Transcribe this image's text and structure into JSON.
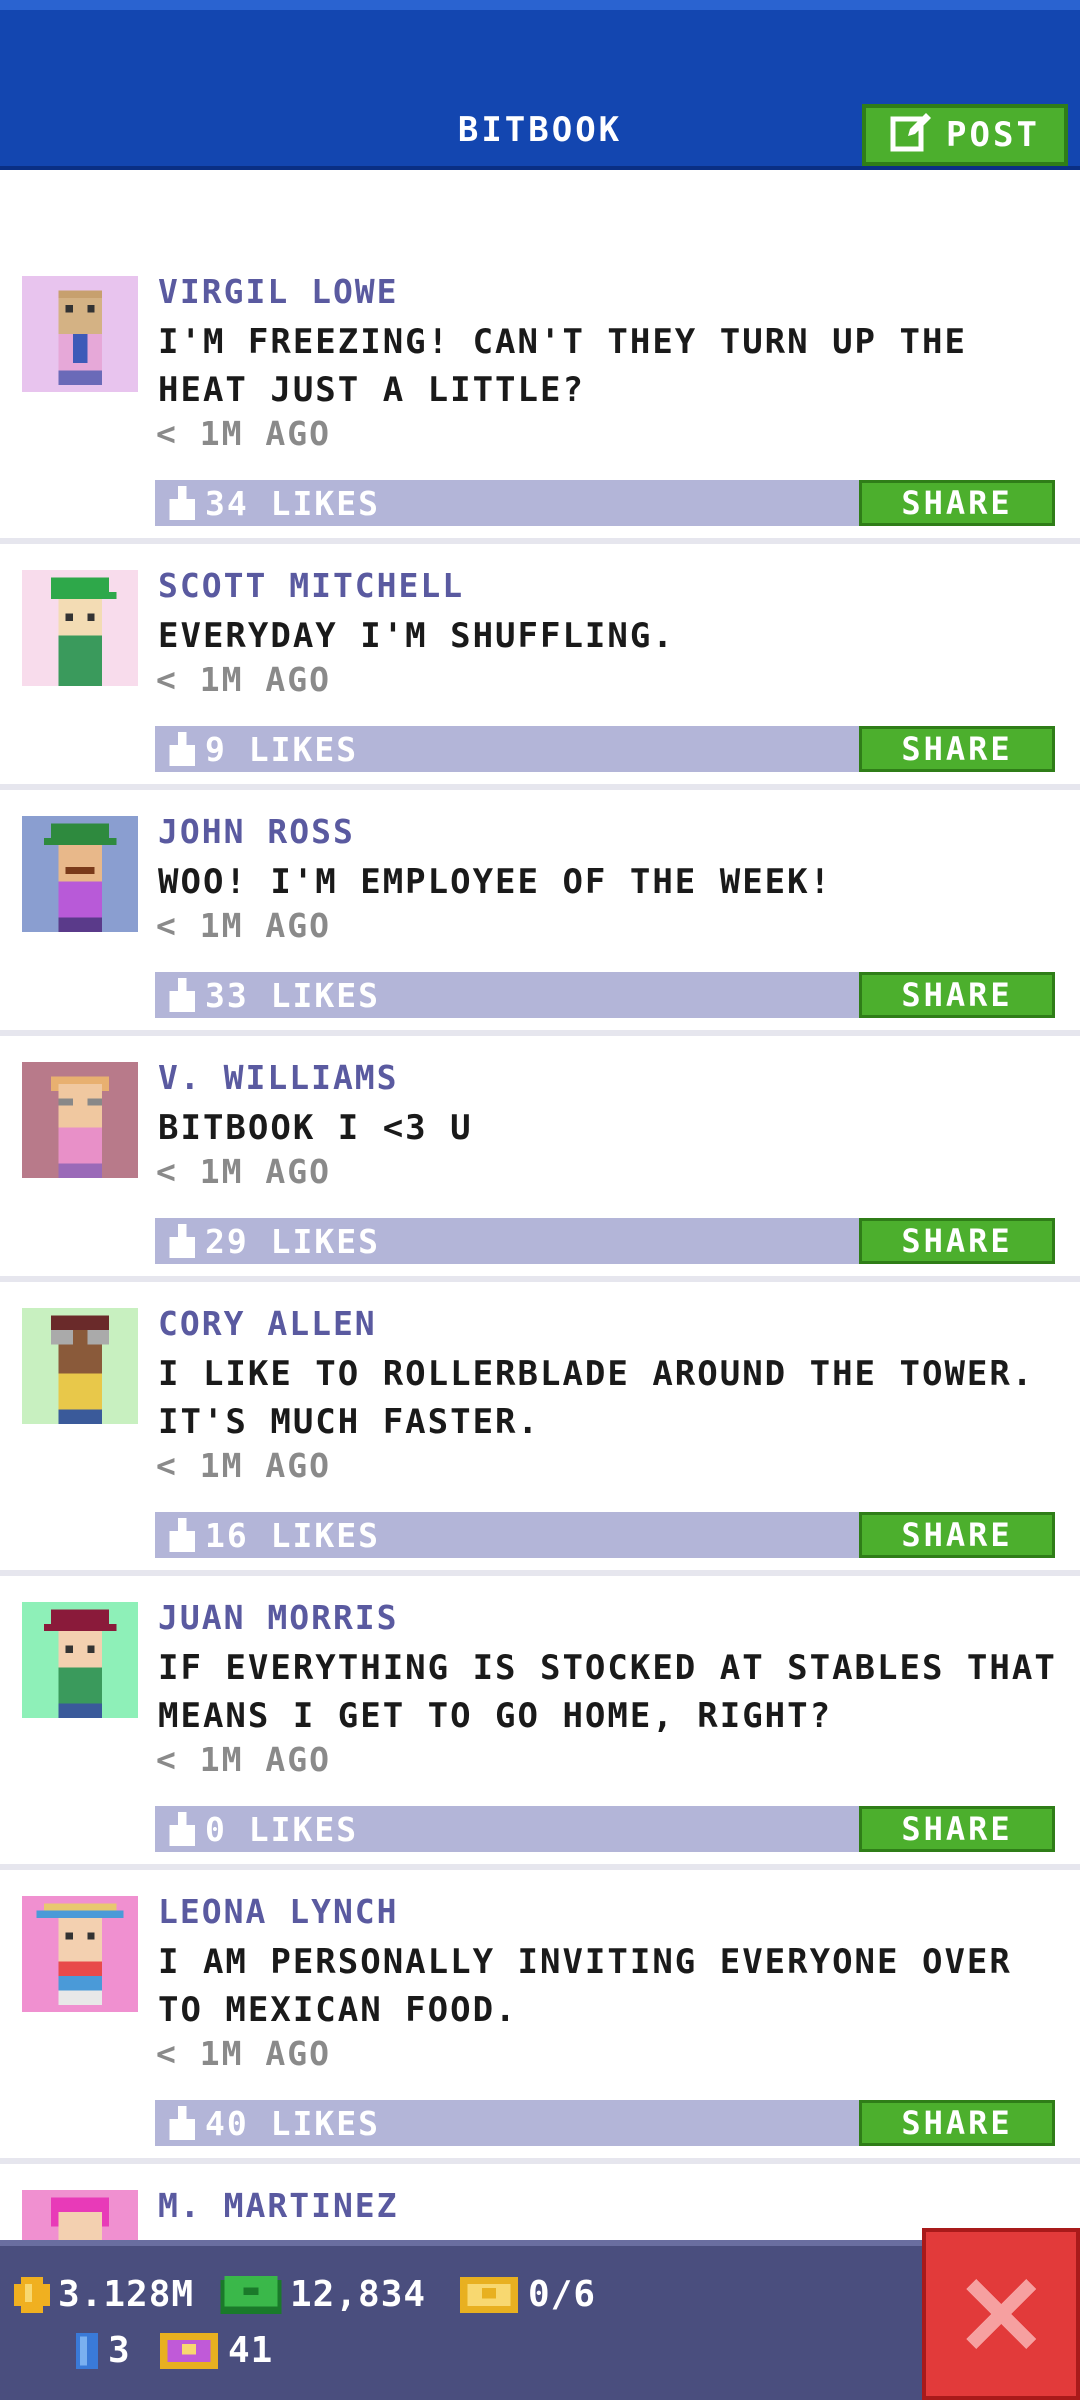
{
  "header": {
    "title": "BITBOOK",
    "post_label": "POST"
  },
  "posts": [
    {
      "name": "VIRGIL LOWE",
      "message": "I'M FREEZING! CAN'T THEY TURN UP THE HEAT JUST A LITTLE?",
      "time": "< 1M AGO",
      "likes": "34 LIKES",
      "share": "SHARE"
    },
    {
      "name": "SCOTT MITCHELL",
      "message": "EVERYDAY I'M SHUFFLING.",
      "time": "< 1M AGO",
      "likes": "9 LIKES",
      "share": "SHARE"
    },
    {
      "name": "JOHN ROSS",
      "message": "WOO! I'M EMPLOYEE OF THE WEEK!",
      "time": "< 1M AGO",
      "likes": "33 LIKES",
      "share": "SHARE"
    },
    {
      "name": "V. WILLIAMS",
      "message": "BITBOOK I <3 U",
      "time": "< 1M AGO",
      "likes": "29 LIKES",
      "share": "SHARE"
    },
    {
      "name": "CORY ALLEN",
      "message": "I LIKE TO ROLLERBLADE AROUND THE TOWER. IT'S MUCH FASTER.",
      "time": "< 1M AGO",
      "likes": "16 LIKES",
      "share": "SHARE"
    },
    {
      "name": "JUAN MORRIS",
      "message": "IF EVERYTHING IS STOCKED AT STABLES THAT MEANS I GET TO GO HOME, RIGHT?",
      "time": "< 1M AGO",
      "likes": "0 LIKES",
      "share": "SHARE"
    },
    {
      "name": "LEONA LYNCH",
      "message": "I AM PERSONALLY INVITING EVERYONE OVER TO MEXICAN FOOD.",
      "time": "< 1M AGO",
      "likes": "40 LIKES",
      "share": "SHARE"
    },
    {
      "name": "M. MARTINEZ"
    }
  ],
  "status": {
    "coins": "3.128M",
    "bux": "12,834",
    "tickets": "0/6",
    "gems": "3",
    "vip": "41"
  },
  "colors": {
    "header": "#1346b0",
    "accent_green": "#4caf2d",
    "like_bar": "#b3b5d8",
    "close_red": "#e23a3a",
    "bottom_bar": "#4a4e7e"
  }
}
